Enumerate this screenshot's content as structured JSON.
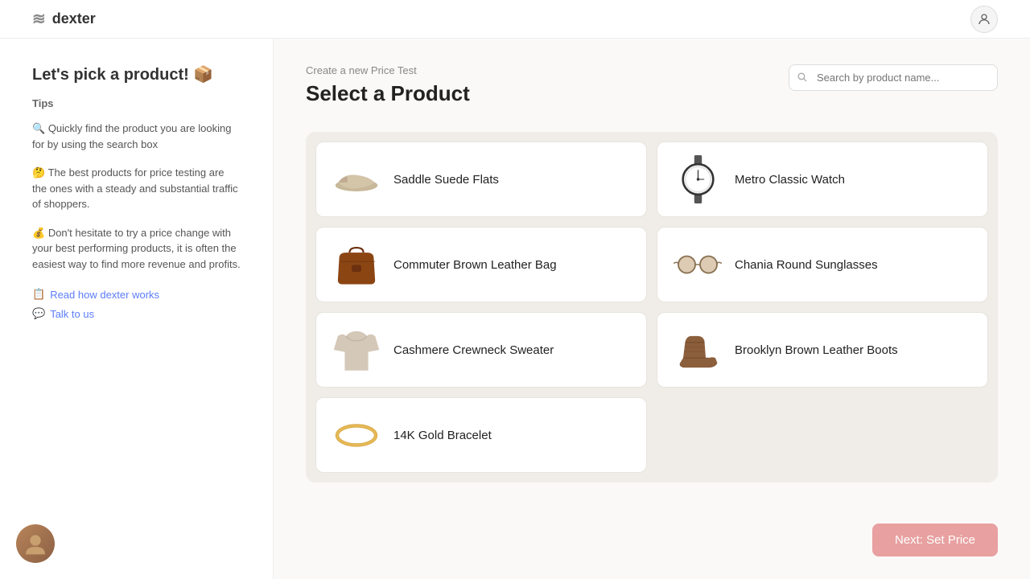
{
  "header": {
    "logo_text": "dexter",
    "user_icon": "👤"
  },
  "sidebar": {
    "title": "Let's pick a product! 📦",
    "tips_label": "Tips",
    "tips": [
      {
        "icon": "🔍",
        "text": "Quickly find the product you are looking for by using the search box"
      },
      {
        "icon": "🤔",
        "text": "The best products for price testing are the ones with a steady and substantial traffic of shoppers."
      },
      {
        "icon": "💰",
        "text": "Don't hesitate to try a price change with your best performing products, it is often the easiest way to find more revenue and profits."
      }
    ],
    "links": [
      {
        "icon": "📋",
        "text": "Read how dexter works"
      },
      {
        "icon": "💬",
        "text": "Talk to us"
      }
    ]
  },
  "content": {
    "subtitle": "Create a new Price Test",
    "title": "Select a Product",
    "search_placeholder": "Search by product name..."
  },
  "products": [
    {
      "id": 1,
      "name": "Saddle Suede Flats",
      "emoji": "👟",
      "col": 0
    },
    {
      "id": 2,
      "name": "Metro Classic Watch",
      "emoji": "⌚",
      "col": 1
    },
    {
      "id": 3,
      "name": "Commuter Brown Leather Bag",
      "emoji": "👜",
      "col": 0
    },
    {
      "id": 4,
      "name": "Chania Round Sunglasses",
      "emoji": "🕶️",
      "col": 1
    },
    {
      "id": 5,
      "name": "Cashmere Crewneck Sweater",
      "emoji": "👕",
      "col": 0
    },
    {
      "id": 6,
      "name": "Brooklyn Brown Leather Boots",
      "emoji": "👢",
      "col": 1
    },
    {
      "id": 7,
      "name": "14K Gold Bracelet",
      "emoji": "📿",
      "col": 0
    }
  ],
  "next_button": {
    "label": "Next: Set Price"
  }
}
